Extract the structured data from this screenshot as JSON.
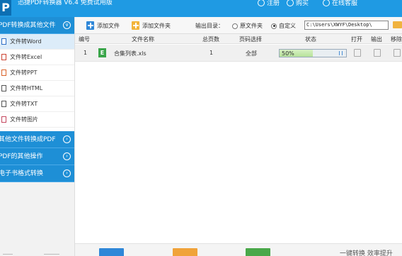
{
  "app": {
    "logo": "P",
    "title": "迅捷PDF转换器 V6.4 免费试用版"
  },
  "titlebar": {
    "actions": [
      {
        "label": "注册",
        "icon": "register-icon"
      },
      {
        "label": "购买",
        "icon": "cart-icon"
      },
      {
        "label": "在线客服",
        "icon": "service-icon"
      }
    ]
  },
  "sidebar": {
    "groups": [
      {
        "label": "PDF转换成其他文件",
        "toggle": "∨",
        "expanded": true,
        "items": [
          {
            "label": "文件转Word",
            "icon": "word-file-icon",
            "active": true
          },
          {
            "label": "文件转Excel",
            "icon": "excel-file-icon"
          },
          {
            "label": "文件转PPT",
            "icon": "ppt-file-icon"
          },
          {
            "label": "文件转HTML",
            "icon": "html-file-icon"
          },
          {
            "label": "文件转TXT",
            "icon": "txt-file-icon"
          },
          {
            "label": "文件转图片",
            "icon": "image-file-icon"
          }
        ]
      },
      {
        "label": "其他文件转换成PDF",
        "toggle": "›"
      },
      {
        "label": "PDF的其他操作",
        "toggle": "›"
      },
      {
        "label": "电子书格式转换",
        "toggle": "›"
      }
    ]
  },
  "toolbar": {
    "add_file": "添加文件",
    "add_folder": "添加文件夹",
    "output_dir_label": "输出目录：",
    "radio_original": "原文件夹",
    "radio_custom": "自定义",
    "selected_radio": "自定义",
    "output_path": "C:\\Users\\XWYF\\Desktop\\"
  },
  "table": {
    "columns": [
      "编号",
      "文件名称",
      "总页数",
      "页码选择",
      "状态",
      "打开",
      "输出",
      "移除"
    ],
    "rows": [
      {
        "index": "1",
        "type_badge": "E",
        "filename": "合集列表.xls",
        "pages": "1",
        "page_selection": "全部",
        "progress": 0.5,
        "status_text": "50%"
      }
    ]
  },
  "bottom": {
    "slogan": "一键转换  效率提升"
  },
  "colors": {
    "brand_blue": "#1f9ae3",
    "sidebar_group": "#1e8fd6",
    "active_item": "#dcecf9",
    "progress_green": "#b6e29a",
    "excel_green": "#3aa54a"
  }
}
